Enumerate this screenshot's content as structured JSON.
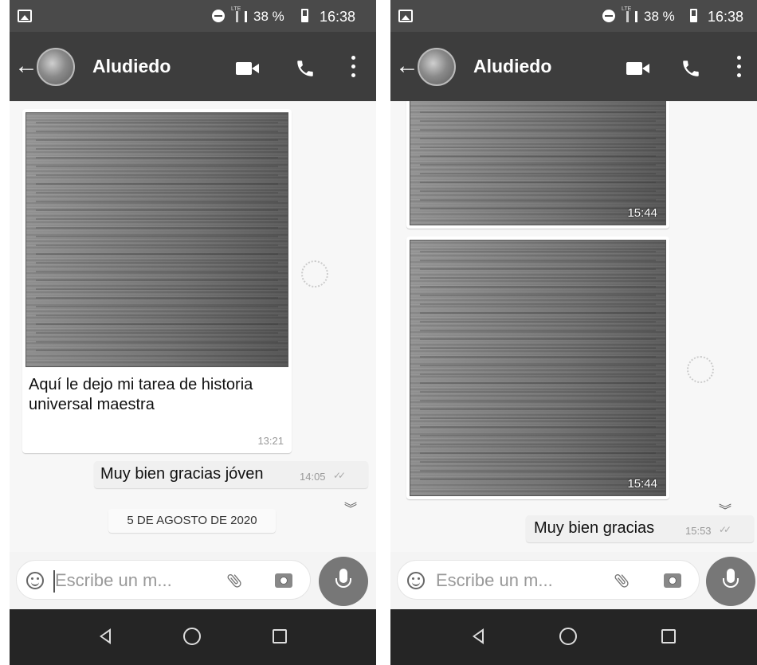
{
  "status_bar": {
    "battery_percent": "38 %",
    "time": "16:38",
    "network_label": "LTE"
  },
  "app_bar": {
    "contact_name": "Aludiedo",
    "back_arrow": "←"
  },
  "left_screen": {
    "image_message": {
      "caption": "Aquí le dejo mi tarea de historia universal maestra",
      "time": "13:21"
    },
    "outgoing_message": {
      "text": "Muy bien gracias jóven",
      "time": "14:05"
    },
    "date_separator": "5 DE AGOSTO DE 2020"
  },
  "right_screen": {
    "image_messages": [
      {
        "time": "15:44"
      },
      {
        "time": "15:44"
      }
    ],
    "outgoing_message": {
      "text": "Muy bien gracias",
      "time": "15:53"
    }
  },
  "input_bar": {
    "left_placeholder": "Escribe un m...",
    "right_placeholder": "Escribe un m..."
  },
  "icons": [
    "gallery-icon",
    "dnd-icon",
    "signal-icon",
    "battery-icon",
    "back-arrow-icon",
    "video-call-icon",
    "voice-call-icon",
    "more-options-icon",
    "emoji-icon",
    "attach-icon",
    "camera-icon",
    "mic-icon",
    "nav-back-icon",
    "nav-home-icon",
    "nav-recents-icon",
    "scroll-down-icon"
  ],
  "colors": {
    "app_bar": "#3d3d3d",
    "status_bar": "#4a4a4a",
    "nav_bar": "#252525",
    "chat_background": "#f7f7f7"
  }
}
